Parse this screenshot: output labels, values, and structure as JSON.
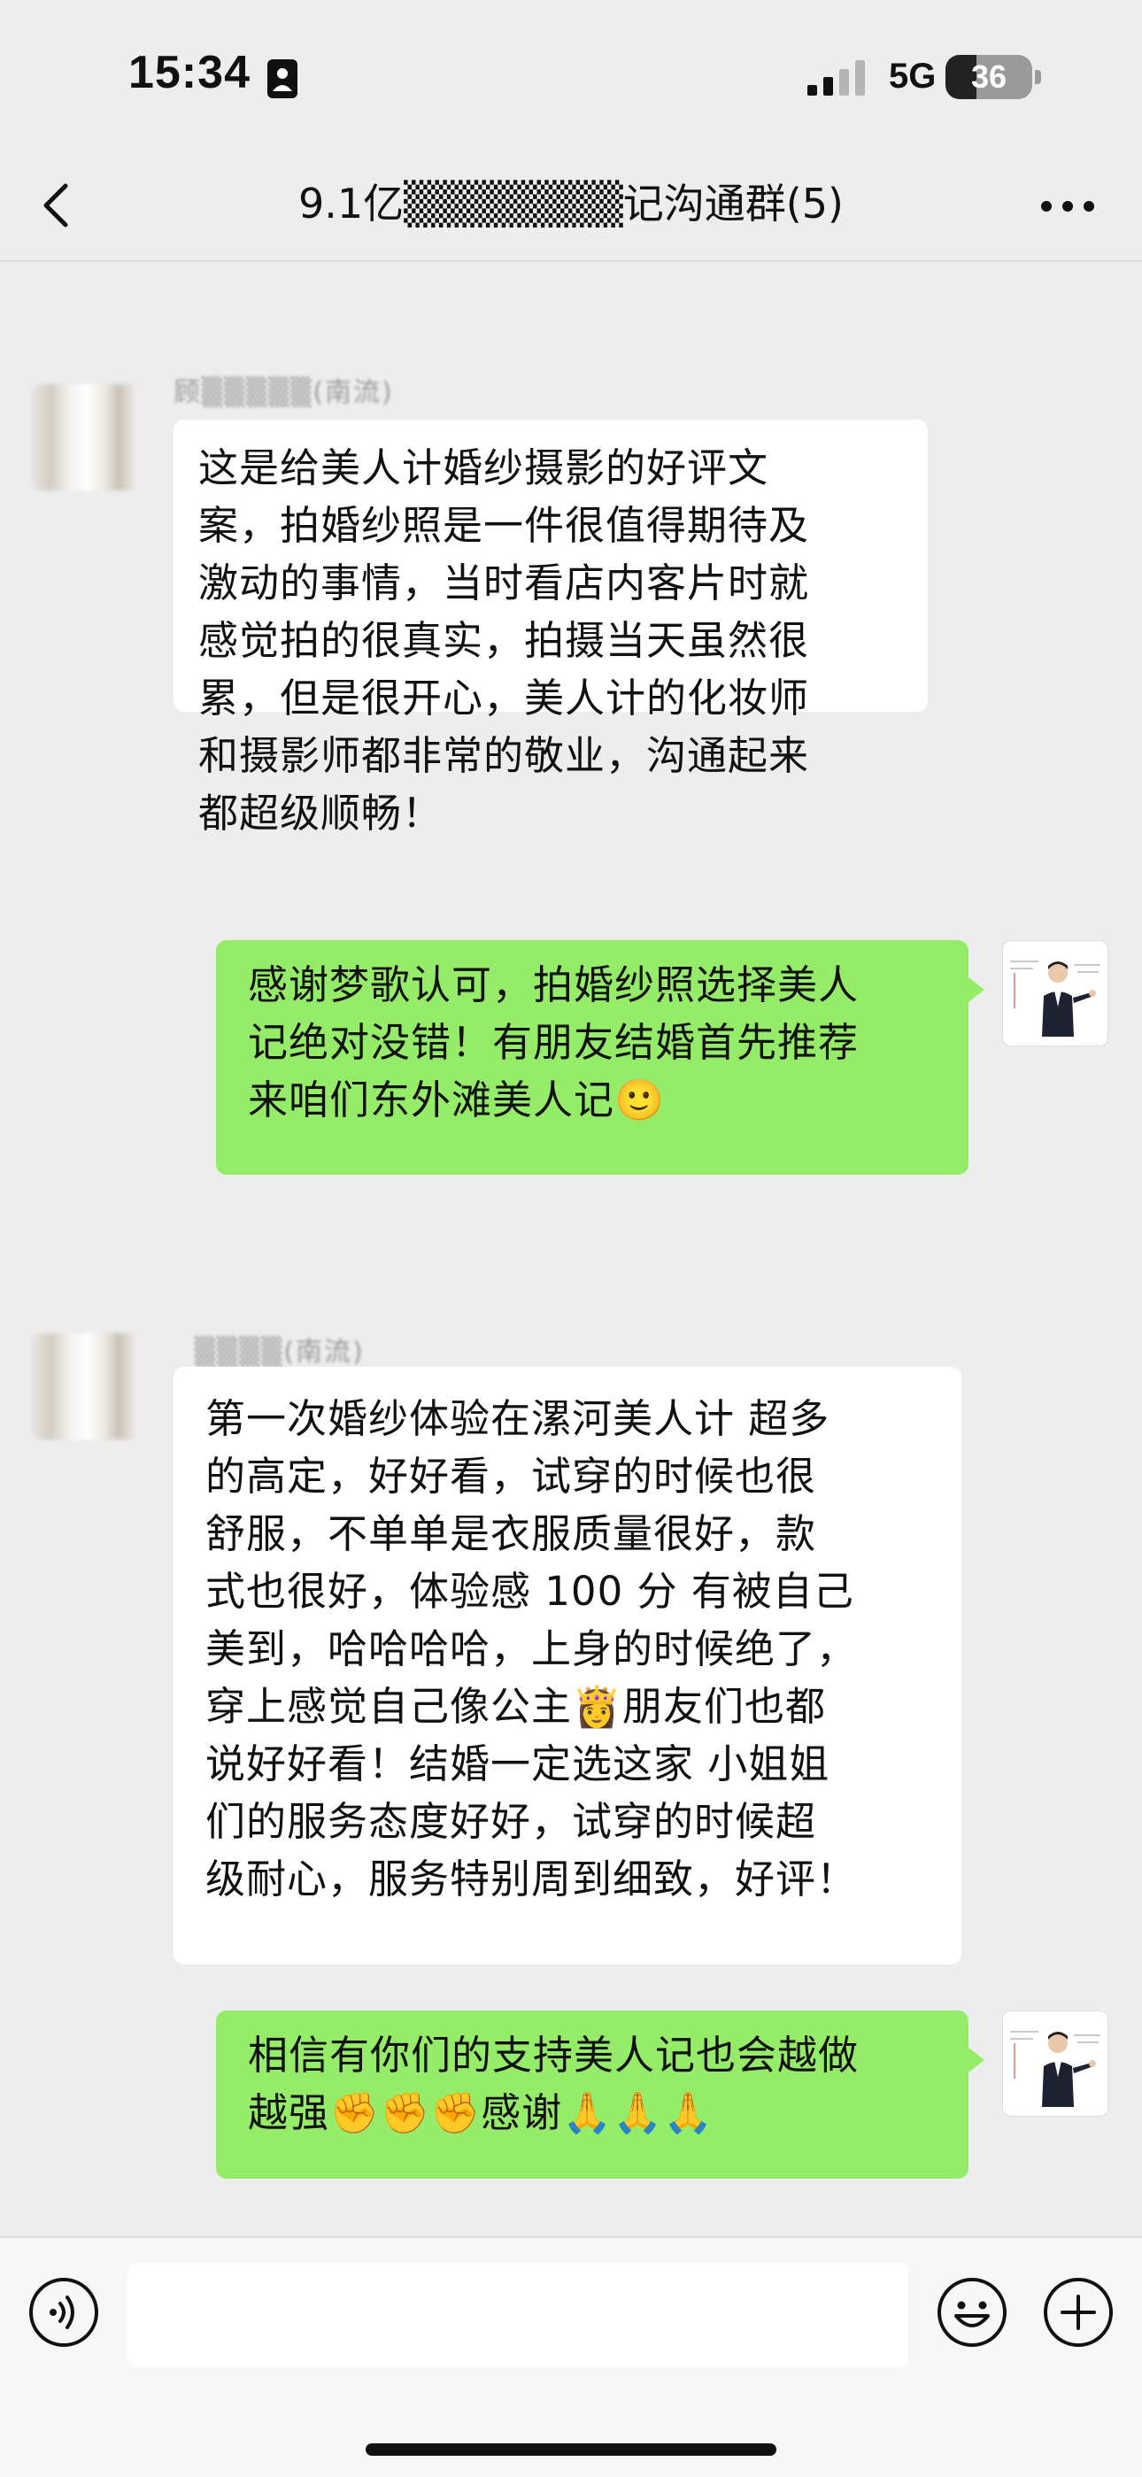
{
  "status_bar": {
    "time": "15:34",
    "network": "5G",
    "battery": "36",
    "battery_level": 0.36
  },
  "nav": {
    "title": "9.1亿▒▒▒▒▒▒▒记沟通群(5)"
  },
  "messages": [
    {
      "direction": "incoming",
      "sender": "顾▒▒▒▒▒(南流)",
      "text": "这是给美人计婚纱摄影的好评文\n案，拍婚纱照是一件很值得期待及\n激动的事情，当时看店内客片时就\n感觉拍的很真实，拍摄当天虽然很\n累，但是很开心，美人计的化妆师\n和摄影师都非常的敬业，沟通起来\n都超级顺畅！"
    },
    {
      "direction": "outgoing",
      "text": "感谢梦歌认可，拍婚纱照选择美人\n记绝对没错！有朋友结婚首先推荐\n来咱们东外滩美人记🙂"
    },
    {
      "direction": "incoming",
      "sender": "▒▒▒▒(南流)",
      "text": "第一次婚纱体验在漯河美人计 超多\n的高定，好好看，试穿的时候也很\n舒服，不单单是衣服质量很好，款\n式也很好，体验感 100 分 有被自己\n美到，哈哈哈哈，上身的时候绝了，\n穿上感觉自己像公主👸朋友们也都\n说好好看！结婚一定选这家 小姐姐\n们的服务态度好好，试穿的时候超\n级耐心，服务特别周到细致，好评！"
    },
    {
      "direction": "outgoing",
      "text": "相信有你们的支持美人记也会越做\n越强✊✊✊感谢🙏🙏🙏"
    }
  ],
  "colors": {
    "background": "#ededed",
    "outgoing_bubble": "#95ec69",
    "incoming_bubble": "#ffffff"
  },
  "icons": {
    "back": "chevron-left-icon",
    "more": "more-horizontal-icon",
    "voice": "voice-icon",
    "emoji": "emoji-icon",
    "plus": "plus-icon"
  },
  "input": {
    "value": "",
    "placeholder": ""
  }
}
